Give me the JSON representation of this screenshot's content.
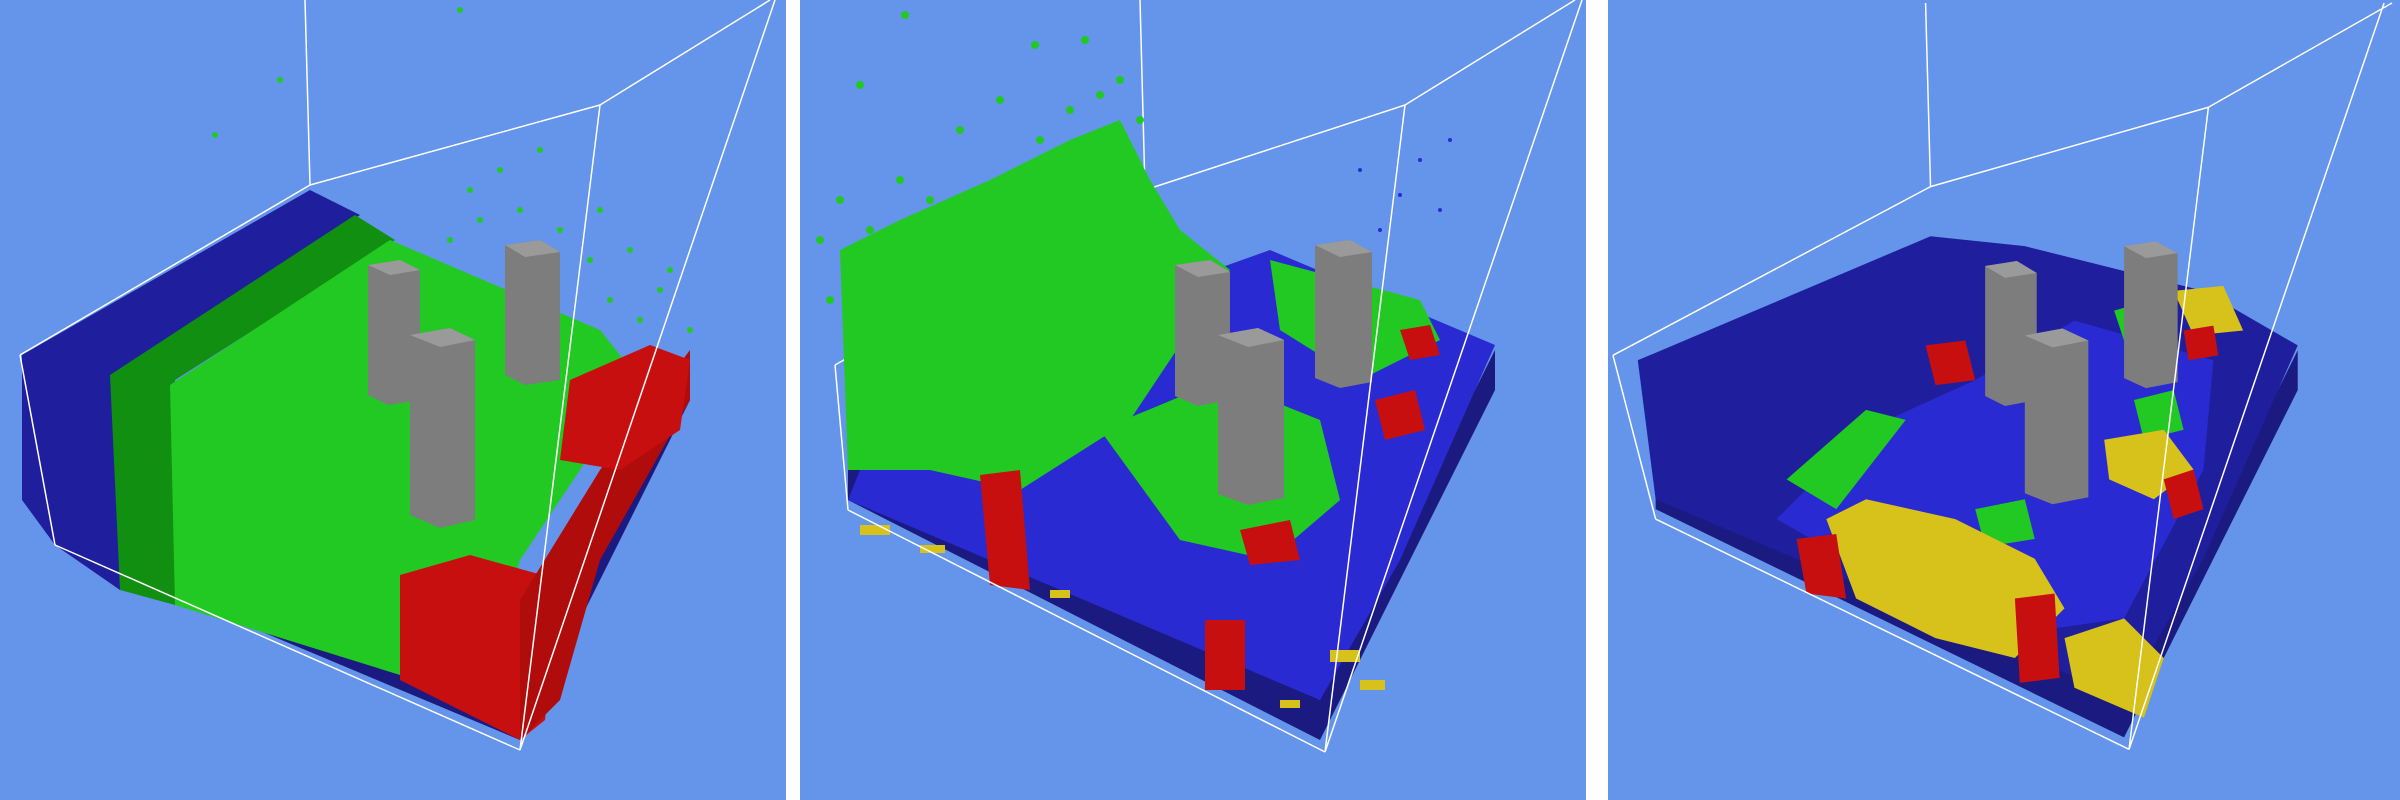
{
  "figure": {
    "panel_count": 3,
    "background_color": "#6495ea",
    "separator_color": "#ffffff",
    "panels": [
      {
        "id": "panel-1",
        "description_key": "dam-break-start"
      },
      {
        "id": "panel-2",
        "description_key": "dam-break-mid"
      },
      {
        "id": "panel-3",
        "description_key": "dam-break-late"
      }
    ]
  },
  "colors": {
    "dark_blue": "#1f1f9e",
    "blue": "#2a2ad2",
    "dark_green": "#118f11",
    "green": "#22c922",
    "red": "#c80f0f",
    "yellow": "#d6c21a",
    "gray": "#7d7d7d",
    "box_line": "#ffffff"
  }
}
